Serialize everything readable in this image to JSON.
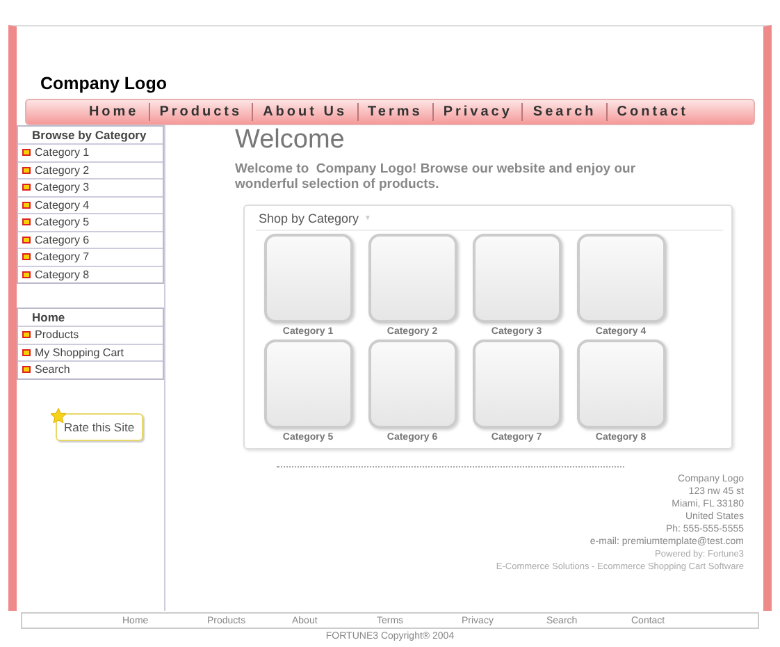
{
  "logo": "Company Logo",
  "nav": [
    "Home",
    "Products",
    "About Us",
    "Terms",
    "Privacy",
    "Search",
    "Contact"
  ],
  "categories_box": {
    "title": "Browse by Category",
    "items": [
      "Category 1",
      "Category 2",
      "Category 3",
      "Category 4",
      "Category 5",
      "Category 6",
      "Category 7",
      "Category 8"
    ]
  },
  "links_box": {
    "title": "Home",
    "items": [
      "Products",
      "My Shopping Cart",
      "Search"
    ]
  },
  "rate_button": "Rate this Site",
  "heading": "Welcome",
  "intro": "Welcome to  Company Logo! Browse our website and enjoy our wonderful selection of products.",
  "shop": {
    "title": "Shop by Category",
    "caret": "▼",
    "tiles": [
      "Category 1",
      "Category 2",
      "Category 3",
      "Category 4",
      "Category 5",
      "Category 6",
      "Category 7",
      "Category 8"
    ]
  },
  "address": [
    "Company Logo",
    "123 nw 45 st",
    "Miami, FL 33180",
    "United States",
    "Ph: 555-555-5555",
    "e-mail: premiumtemplate@test.com"
  ],
  "powered": [
    "Powered by: Fortune3",
    "E-Commerce Solutions - Ecommerce Shopping Cart Software"
  ],
  "footer_nav": [
    "Home",
    "Products",
    "About",
    "Terms",
    "Privacy",
    "Search",
    "Contact"
  ],
  "copyright": "FORTUNE3 Copyright® 2004"
}
